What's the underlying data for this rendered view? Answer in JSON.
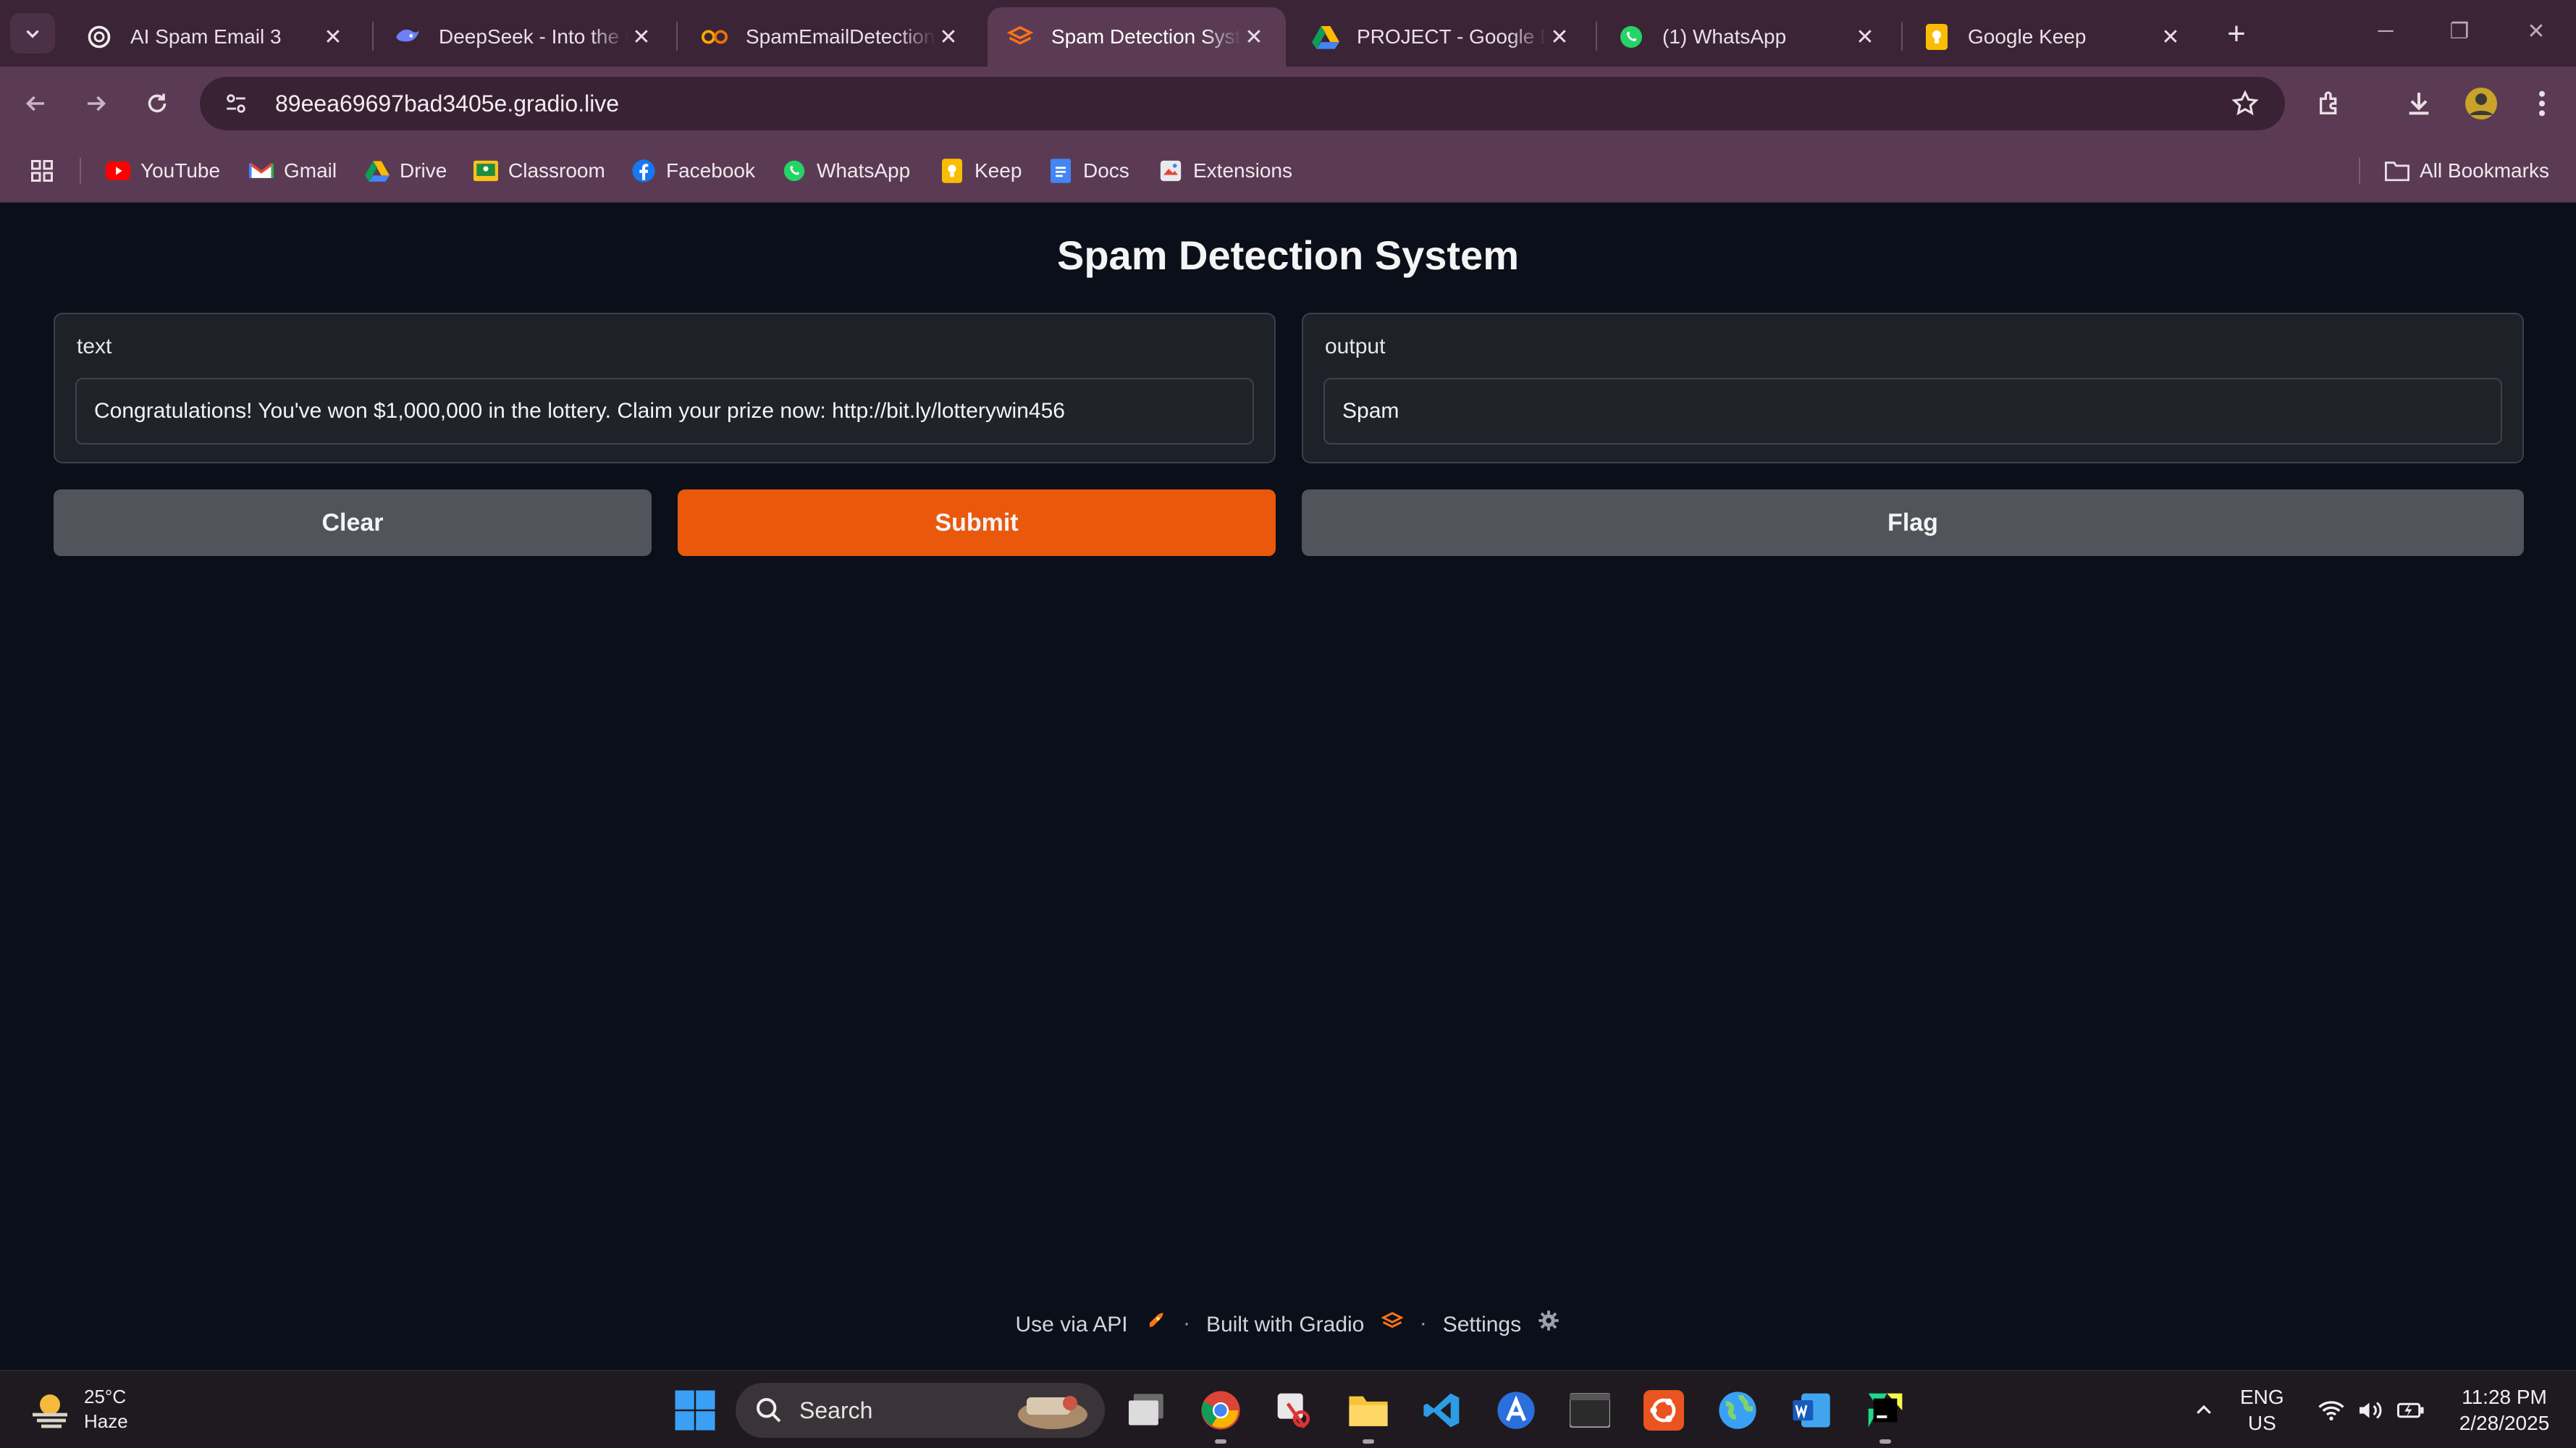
{
  "browser": {
    "tabs": [
      {
        "title": "AI Spam Email 3",
        "icon": "openai-icon",
        "active": false
      },
      {
        "title": "DeepSeek - Into the Unknown",
        "icon": "deepseek-icon",
        "active": false
      },
      {
        "title": "SpamEmailDetection.ipynb",
        "icon": "colab-icon",
        "active": false
      },
      {
        "title": "Spam Detection System",
        "icon": "gradio-icon",
        "active": true
      },
      {
        "title": "PROJECT - Google Drive",
        "icon": "drive-icon",
        "active": false
      },
      {
        "title": "(1) WhatsApp",
        "icon": "whatsapp-icon",
        "active": false
      },
      {
        "title": "Google Keep",
        "icon": "keep-icon",
        "active": false
      }
    ],
    "url": "89eea69697bad3405e.gradio.live",
    "bookmarks": [
      {
        "label": "YouTube",
        "icon": "youtube-icon"
      },
      {
        "label": "Gmail",
        "icon": "gmail-icon"
      },
      {
        "label": "Drive",
        "icon": "drive-icon"
      },
      {
        "label": "Classroom",
        "icon": "classroom-icon"
      },
      {
        "label": "Facebook",
        "icon": "facebook-icon"
      },
      {
        "label": "WhatsApp",
        "icon": "whatsapp-icon"
      },
      {
        "label": "Keep",
        "icon": "keep-icon"
      },
      {
        "label": "Docs",
        "icon": "docs-icon"
      },
      {
        "label": "Extensions",
        "icon": "extensions-icon"
      }
    ],
    "all_bookmarks": "All Bookmarks"
  },
  "app": {
    "title": "Spam Detection System",
    "input": {
      "label": "text",
      "value": "Congratulations! You've won $1,000,000 in the lottery. Claim your prize now: http://bit.ly/lotterywin456"
    },
    "output": {
      "label": "output",
      "value": "Spam"
    },
    "buttons": {
      "clear": "Clear",
      "submit": "Submit",
      "flag": "Flag"
    },
    "footer": {
      "api": "Use via API",
      "built": "Built with Gradio",
      "settings": "Settings",
      "separator": "·"
    },
    "colors": {
      "background": "#0b0f19",
      "panel": "#1f2129",
      "primary": "#ea580c",
      "secondary": "#52545c"
    }
  },
  "taskbar": {
    "weather_temp": "25°C",
    "weather_desc": "Haze",
    "search_label": "Search",
    "lang_top": "ENG",
    "lang_bottom": "US",
    "time": "11:28 PM",
    "date": "2/28/2025"
  }
}
